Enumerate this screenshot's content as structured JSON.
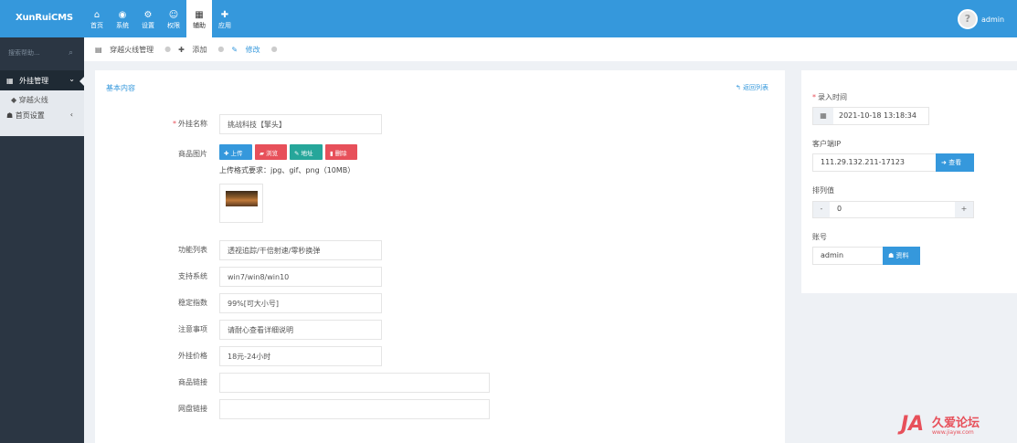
{
  "app": {
    "logo": "XunRuiCMS"
  },
  "topnav": [
    {
      "icon": "⌂",
      "label": "首页"
    },
    {
      "icon": "◉",
      "label": "系统"
    },
    {
      "icon": "⚙",
      "label": "设置"
    },
    {
      "icon": "☺",
      "label": "权限"
    },
    {
      "icon": "▦",
      "label": "辅助"
    },
    {
      "icon": "✚",
      "label": "应用"
    }
  ],
  "user": {
    "avatar": "?",
    "name": "admin"
  },
  "sidebar": {
    "search_placeholder": "搜索帮助...",
    "search_icon": "⌕",
    "active_menu": "外挂管理",
    "active_menu_icon": "▦",
    "active_chevron": "⌄",
    "sub_item": "穿越火线",
    "sub_item_icon": "◆",
    "other_item": "首页设置",
    "other_item_icon": "☗",
    "other_chevron": "‹"
  },
  "breadcrumb": {
    "items": [
      {
        "icon": "▤",
        "label": "穿越火线管理"
      },
      {
        "icon": "✚",
        "label": "添加"
      },
      {
        "icon": "✎",
        "label": "修改"
      }
    ],
    "separator": "●"
  },
  "main": {
    "title": "基本内容",
    "back_link": "↰ 返回列表",
    "fields": [
      {
        "label": "外挂名称",
        "required": "*",
        "value": "挑战科技【擎头】"
      },
      {
        "label": "商品图片"
      },
      {
        "label": "功能列表",
        "value": "透视追踪/干倍射速/零秒换弹"
      },
      {
        "label": "支持系统",
        "value": "win7/win8/win10"
      },
      {
        "label": "稳定指数",
        "value": "99%[可大小号]"
      },
      {
        "label": "注意事项",
        "value": "请耐心查看详细说明"
      },
      {
        "label": "外挂价格",
        "value": "18元-24小时"
      },
      {
        "label": "商品链接",
        "value": ""
      },
      {
        "label": "网盘链接",
        "value": ""
      }
    ],
    "upload_buttons": {
      "upload": "✚ 上传",
      "browse": "▰ 浏览",
      "address": "✎ 地址",
      "delete": "▮ 删除"
    },
    "upload_hint": "上传格式要求：jpg、gif、png（10MB）"
  },
  "right": {
    "time_label": "录入时间",
    "time_required": "*",
    "time_icon": "▦",
    "time_value": "2021-10-18 13:18:34",
    "ip_label": "客户端IP",
    "ip_value": "111.29.132.211-17123",
    "ip_button": "➜ 查看",
    "order_label": "排列值",
    "order_minus": "-",
    "order_value": "0",
    "order_plus": "+",
    "account_label": "账号",
    "account_value": "admin",
    "account_button": "☗ 资料"
  },
  "watermark": {
    "mark": "JA",
    "title": "久爱论坛",
    "url": "www.jiayw.com"
  },
  "colors": {
    "primary": "#3598dc",
    "danger": "#e7505a",
    "success": "#26a69a",
    "sidebar": "#2b3643"
  }
}
